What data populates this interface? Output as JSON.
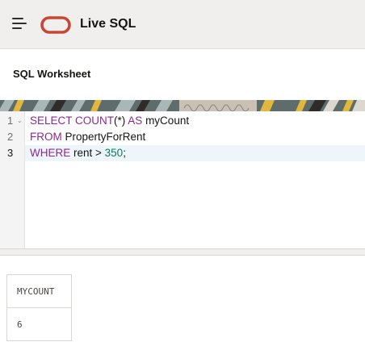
{
  "header": {
    "app_title": "Live SQL",
    "menu_icon": "hamburger-menu-icon",
    "logo": "oracle-logo",
    "brand_color": "#c74634"
  },
  "worksheet": {
    "title": "SQL Worksheet"
  },
  "editor": {
    "line_numbers": [
      "1",
      "2",
      "3"
    ],
    "active_line": 3,
    "lines": [
      [
        {
          "t": "SELECT COUNT",
          "c": "kw"
        },
        {
          "t": "(*) ",
          "c": "plain"
        },
        {
          "t": "AS",
          "c": "kw"
        },
        {
          "t": " myCount",
          "c": "plain"
        }
      ],
      [
        {
          "t": "FROM",
          "c": "kw"
        },
        {
          "t": " PropertyForRent",
          "c": "plain"
        }
      ],
      [
        {
          "t": "WHERE",
          "c": "kw"
        },
        {
          "t": " rent > ",
          "c": "plain"
        },
        {
          "t": "350",
          "c": "num"
        },
        {
          "t": ";",
          "c": "plain"
        }
      ]
    ]
  },
  "results": {
    "columns": [
      "MYCOUNT"
    ],
    "rows": [
      [
        "6"
      ]
    ]
  }
}
